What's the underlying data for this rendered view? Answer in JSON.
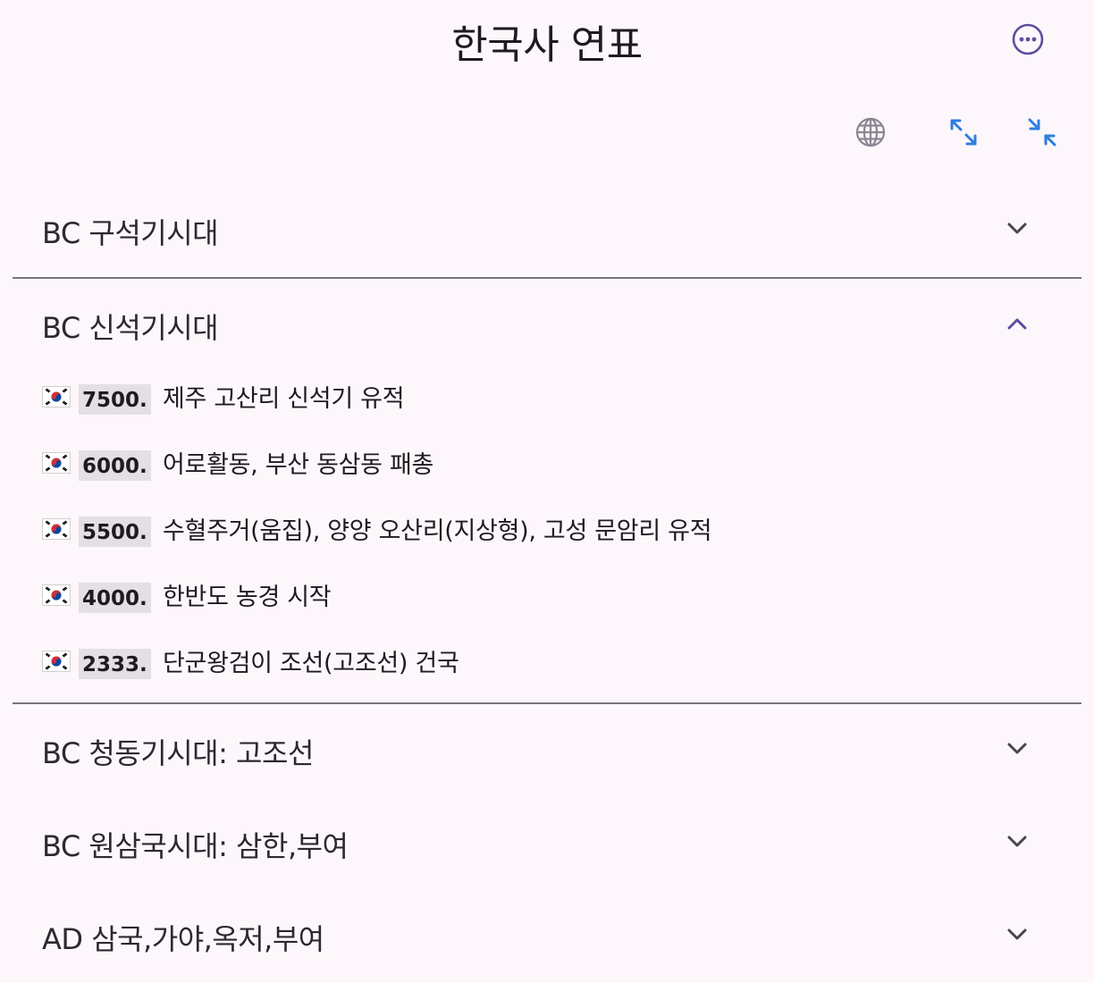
{
  "app": {
    "title": "한국사 연표",
    "more_icon": "more-horizontal-circle-icon",
    "accent_color": "#5c4f9e",
    "tool_icon_color": "#2f7de1"
  },
  "toolbar": {
    "language_icon": "globe-icon",
    "expand_icon": "expand-all-icon",
    "collapse_icon": "collapse-all-icon"
  },
  "sections": [
    {
      "title": "BC 구석기시대",
      "expanded": false,
      "events": []
    },
    {
      "title": "BC 신석기시대",
      "expanded": true,
      "events": [
        {
          "flag": "🇰🇷",
          "year": "7500.",
          "text": "제주 고산리 신석기 유적"
        },
        {
          "flag": "🇰🇷",
          "year": "6000.",
          "text": "어로활동, 부산 동삼동 패총"
        },
        {
          "flag": "🇰🇷",
          "year": "5500.",
          "text": "수혈주거(움집), 양양 오산리(지상형), 고성 문암리 유적"
        },
        {
          "flag": "🇰🇷",
          "year": "4000.",
          "text": "한반도 농경 시작"
        },
        {
          "flag": "🇰🇷",
          "year": "2333.",
          "text": "단군왕검이 조선(고조선) 건국"
        }
      ]
    },
    {
      "title": "BC 청동기시대: 고조선",
      "expanded": false,
      "events": []
    },
    {
      "title": "BC 원삼국시대: 삼한,부여",
      "expanded": false,
      "events": []
    },
    {
      "title": "AD 삼국,가야,옥저,부여",
      "expanded": false,
      "events": []
    }
  ]
}
